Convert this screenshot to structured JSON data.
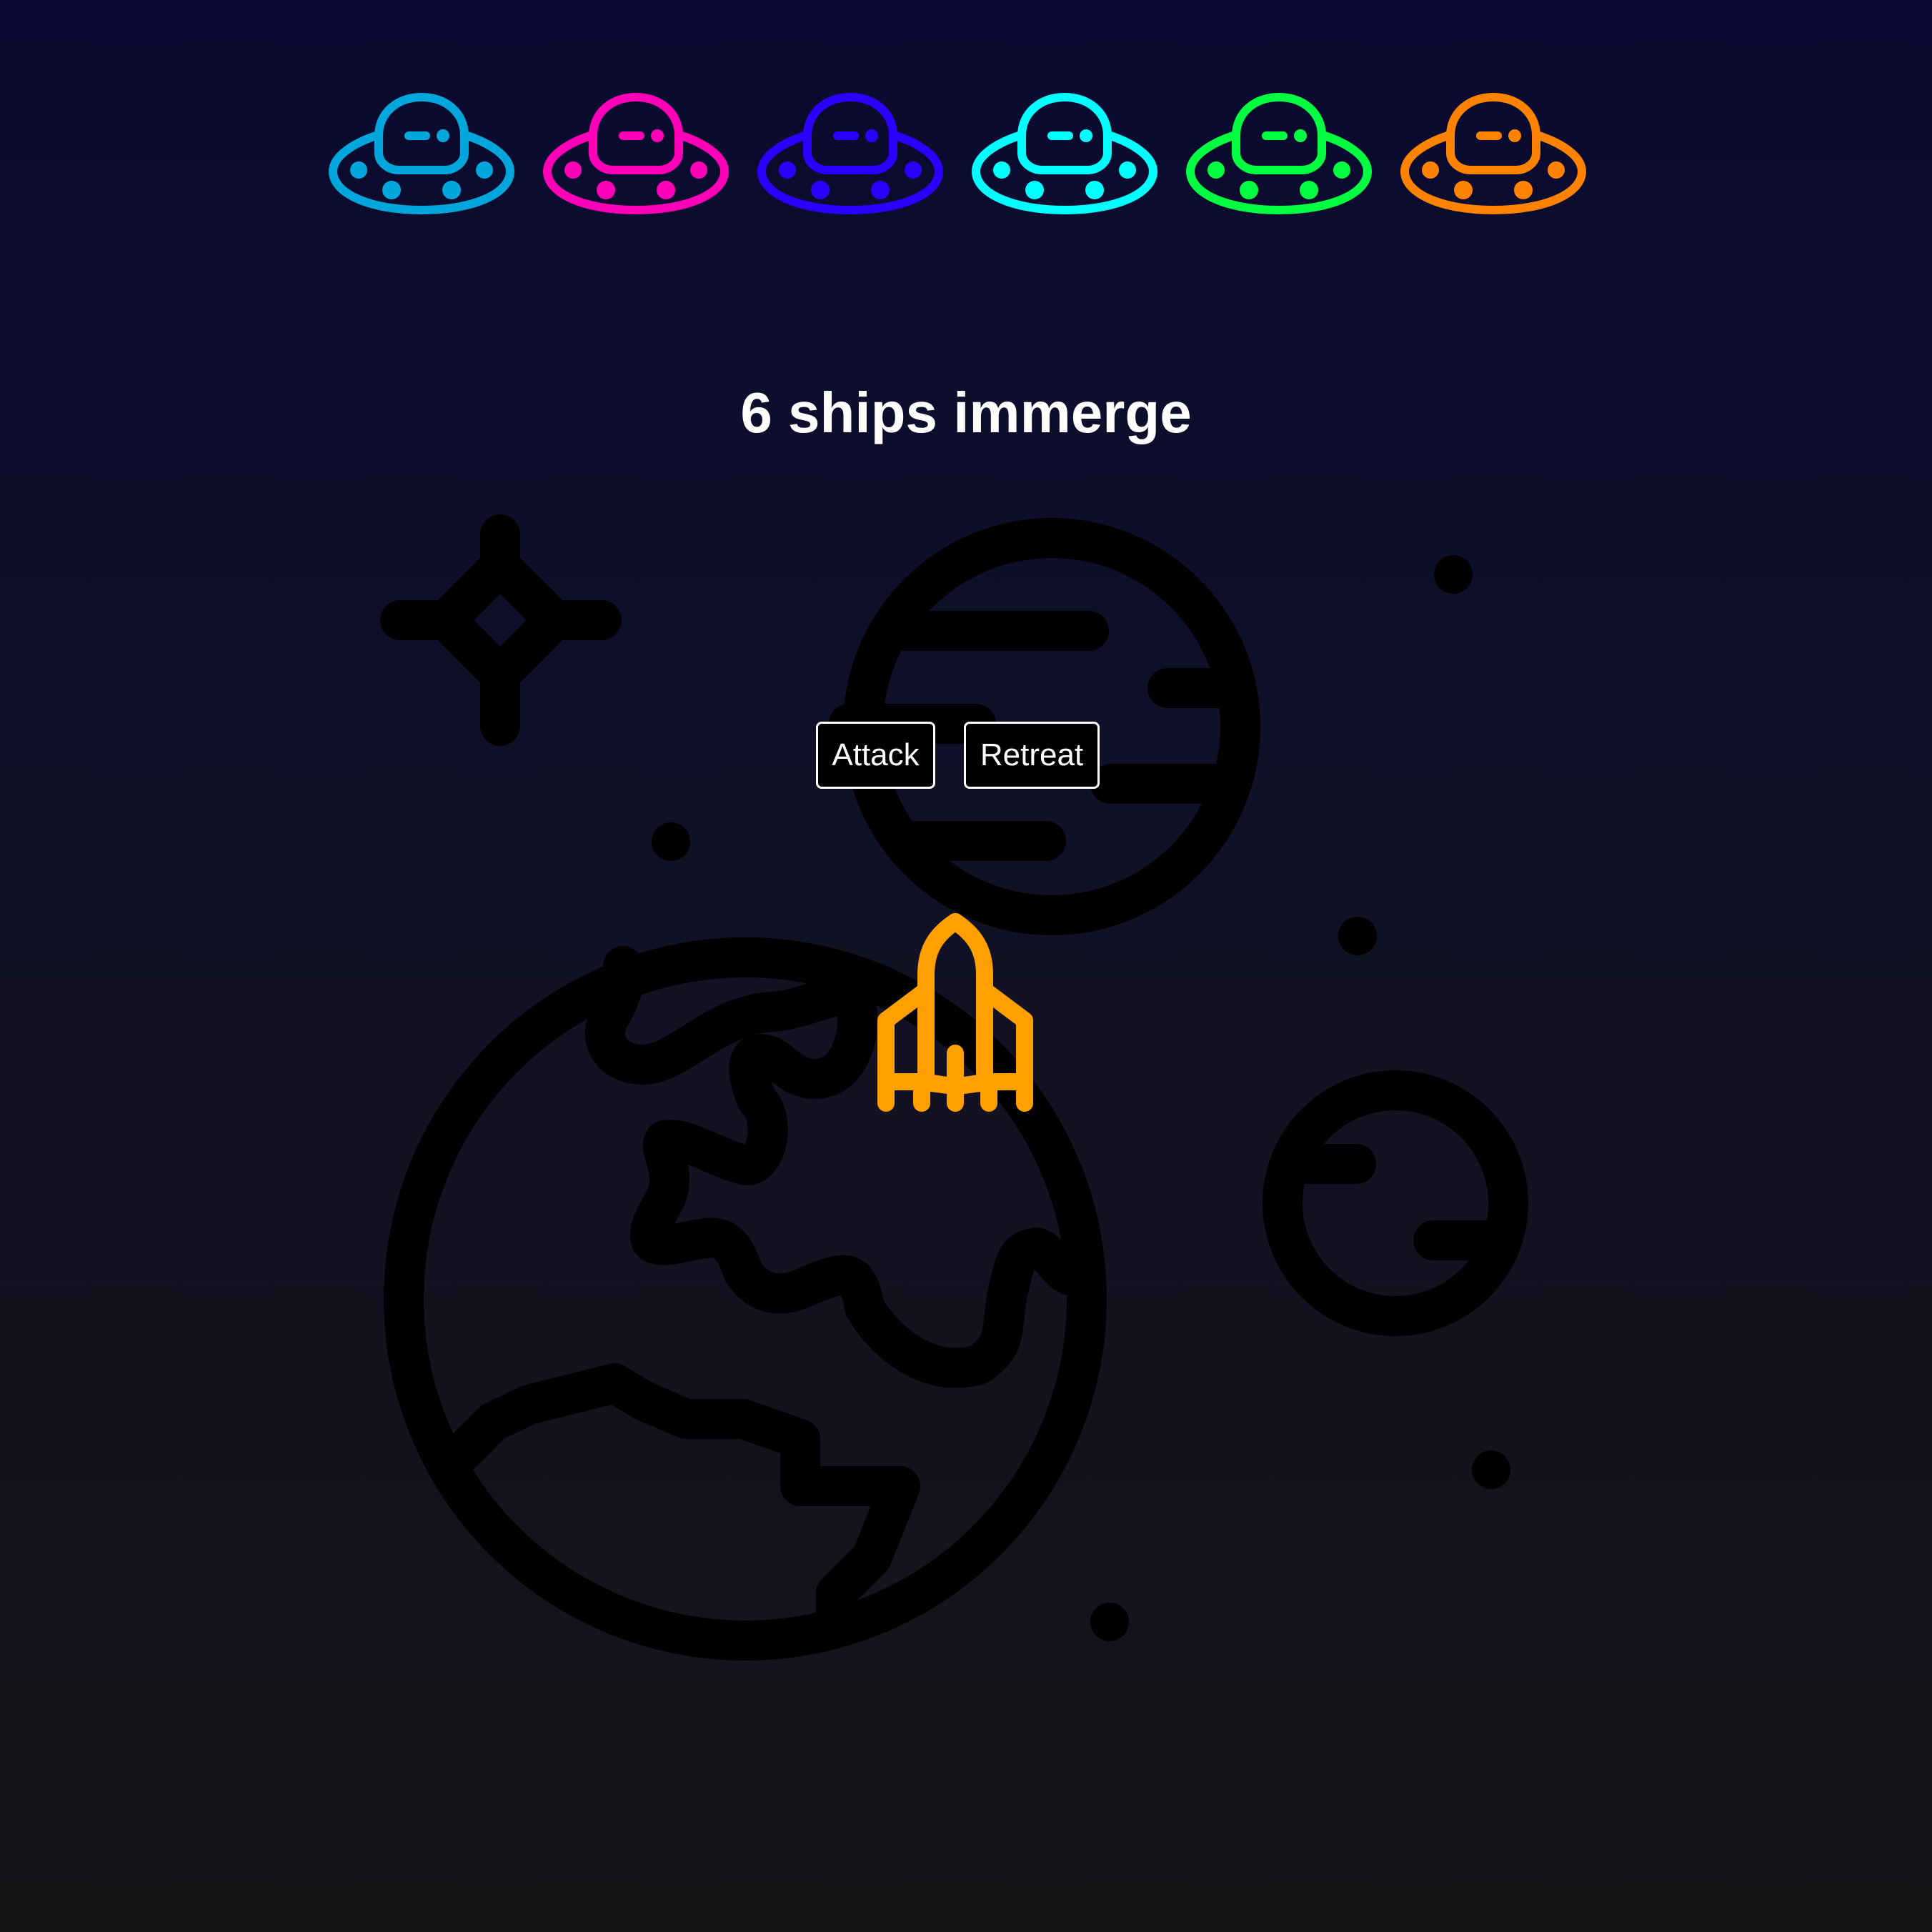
{
  "game": {
    "title": "6 ships immerge"
  },
  "enemy_ships": [
    {
      "icon": "ufo-icon",
      "color": "#00a6dc"
    },
    {
      "icon": "ufo-icon",
      "color": "#ff00b8"
    },
    {
      "icon": "ufo-icon",
      "color": "#2c00ff"
    },
    {
      "icon": "ufo-icon",
      "color": "#00ffff"
    },
    {
      "icon": "ufo-icon",
      "color": "#00ff40"
    },
    {
      "icon": "ufo-icon",
      "color": "#ff8200"
    }
  ],
  "actions": {
    "attack_label": "Attack",
    "retreat_label": "Retreat"
  },
  "player_ship": {
    "icon": "rocket-icon",
    "color": "#ffa000"
  },
  "background": {
    "gradient_top": "#0a0a32",
    "gradient_bottom": "#151518",
    "decor_color": "#000000",
    "decor_icons": [
      "earth-globe-icon",
      "banded-planet-icon",
      "small-planet-icon",
      "sparkle-star-icon",
      "star-dot-icon"
    ]
  }
}
